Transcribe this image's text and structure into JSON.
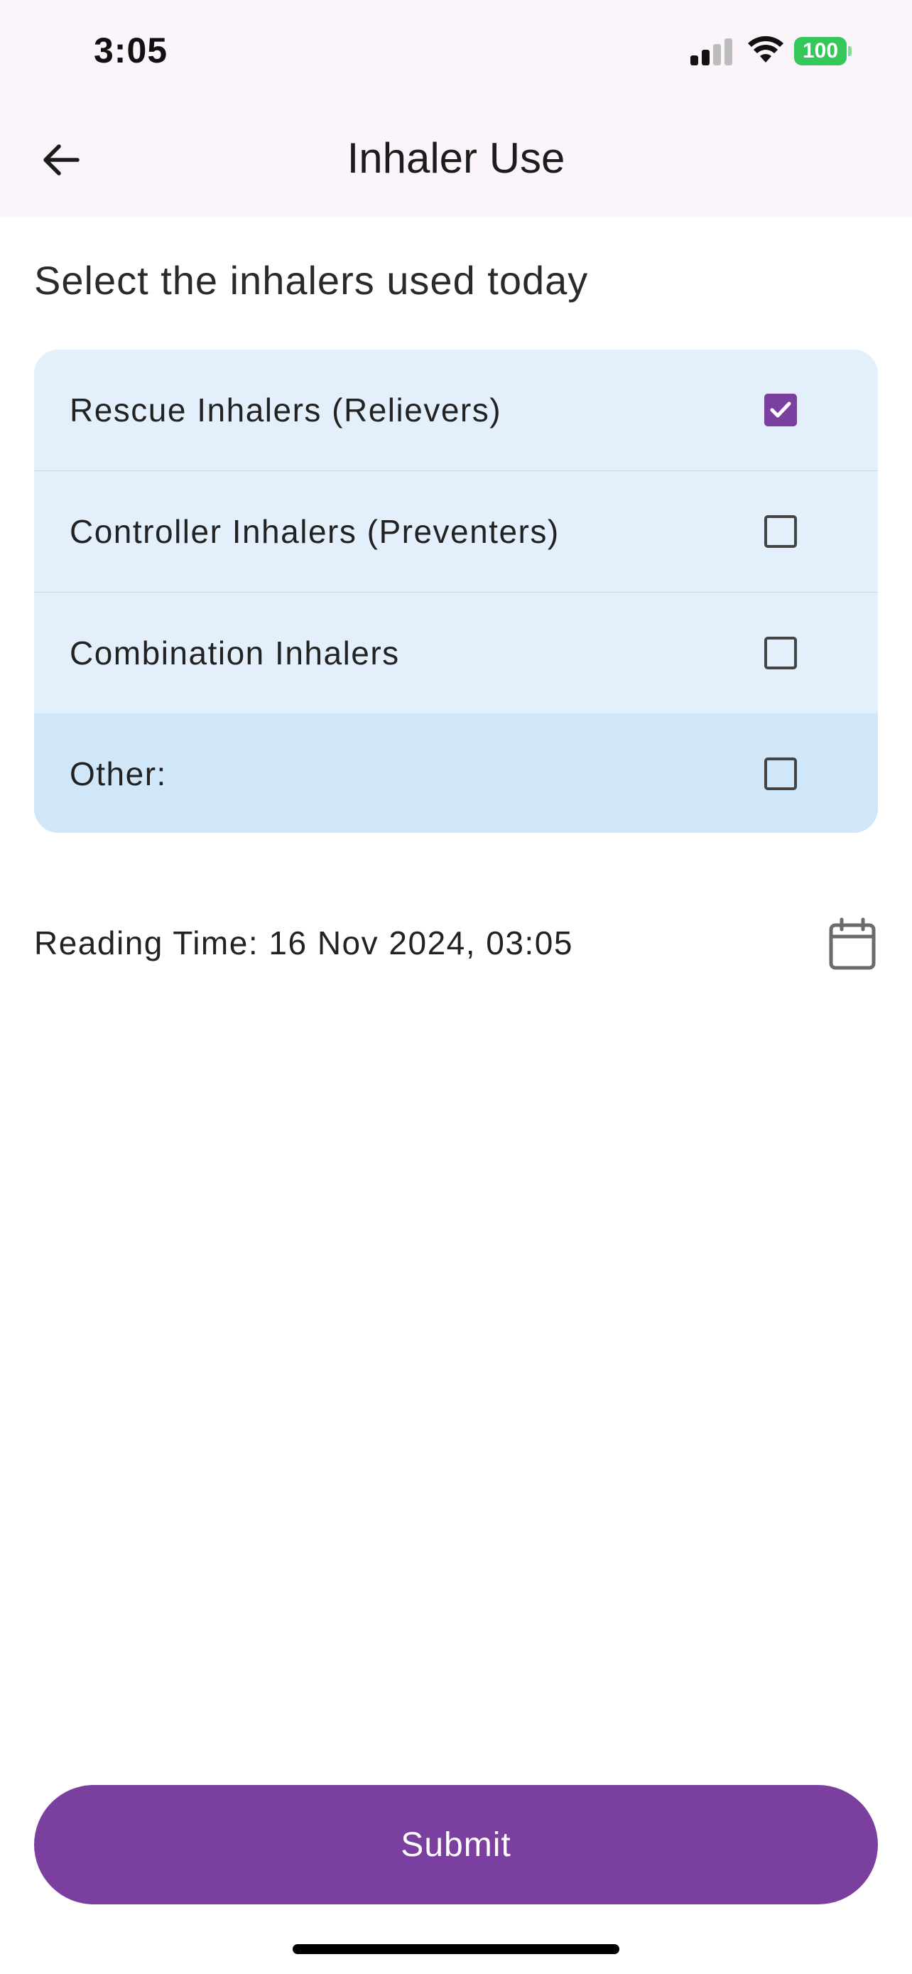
{
  "status_bar": {
    "time": "3:05",
    "battery_level": "100",
    "icons": [
      "signal-icon",
      "wifi-icon",
      "battery-icon"
    ]
  },
  "app_bar": {
    "title": "Inhaler Use",
    "back_icon": "arrow-left-icon"
  },
  "prompt": "Select the inhalers used today",
  "options": [
    {
      "label": "Rescue Inhalers (Relievers)",
      "checked": true
    },
    {
      "label": "Controller Inhalers (Preventers)",
      "checked": false
    },
    {
      "label": "Combination Inhalers",
      "checked": false
    },
    {
      "label": "Other:",
      "checked": false
    }
  ],
  "reading_time": {
    "text": "Reading Time: 16 Nov 2024, 03:05",
    "icon": "calendar-icon"
  },
  "submit_label": "Submit",
  "colors": {
    "accent": "#7b3fa0",
    "header_bg": "#fcf4fb",
    "card_bg": "#e3f0fb",
    "card_highlight": "#d0e6f9",
    "battery": "#34c759"
  }
}
